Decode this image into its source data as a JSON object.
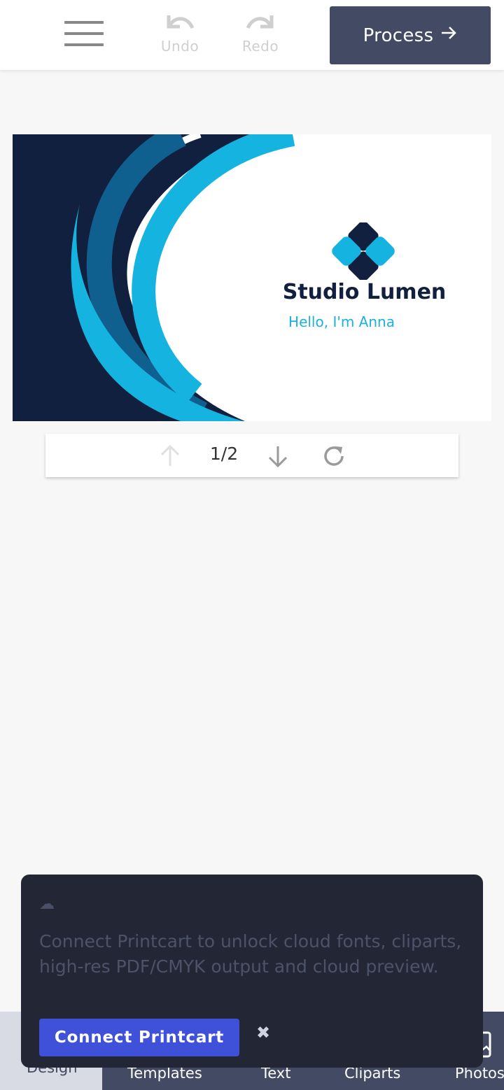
{
  "toolbar": {
    "undo_label": "Undo",
    "redo_label": "Redo",
    "process_label": "Process"
  },
  "card": {
    "company_name": "Studio Lumen",
    "greeting": "Hello, I'm Anna",
    "colors": {
      "navy": "#12203f",
      "teal": "#10608f",
      "cyan": "#15b4e0"
    }
  },
  "pager": {
    "page_indicator": "1/2"
  },
  "bottom_nav": {
    "items": [
      "Design",
      "Templates",
      "Text",
      "Cliparts",
      "Photos"
    ]
  },
  "toast": {
    "message": "Connect Printcart to unlock cloud fonts, cliparts, high-res PDF/CMYK output and cloud preview.",
    "button_label": "Connect Printcart",
    "close_glyph": "✖"
  },
  "colors": {
    "primary_dark": "#434a63",
    "toast_bg": "#232735",
    "connect_button": "#3f51d9"
  }
}
